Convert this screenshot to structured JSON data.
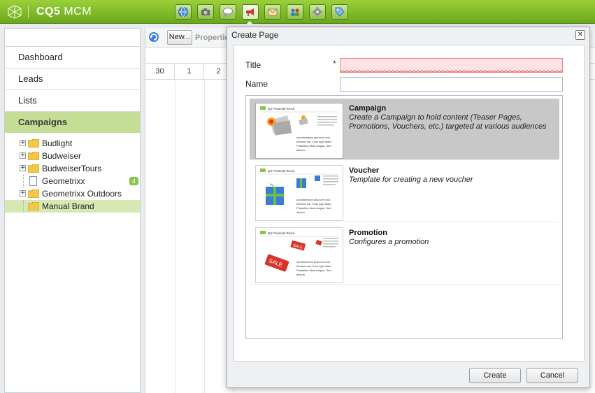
{
  "app": {
    "brand_bold": "CQ5",
    "brand_rest": " MCM"
  },
  "toolbar": {
    "icons": [
      "globe-icon",
      "camera-icon",
      "speech-bubble-icon",
      "megaphone-icon",
      "envelope-icon",
      "users-icon",
      "gear-icon",
      "tag-icon"
    ],
    "active_index": 3
  },
  "sidebar": {
    "nav": [
      "Dashboard",
      "Leads",
      "Lists",
      "Campaigns"
    ],
    "selected_nav": "Campaigns",
    "tree": [
      {
        "label": "Budlight",
        "type": "folder",
        "expandable": true
      },
      {
        "label": "Budweiser",
        "type": "folder",
        "expandable": true
      },
      {
        "label": "BudweiserTours",
        "type": "folder",
        "expandable": true
      },
      {
        "label": "Geometrixx",
        "type": "page",
        "expandable": false,
        "badge": "4"
      },
      {
        "label": "Geometrixx Outdoors",
        "type": "folder",
        "expandable": true
      },
      {
        "label": "Manual Brand",
        "type": "folder",
        "expandable": false,
        "selected": true
      }
    ]
  },
  "calendar": {
    "new_label": "New...",
    "properties_label": "Propertie",
    "days": [
      "30",
      "1",
      "2"
    ]
  },
  "dialog": {
    "title": "Create Page",
    "close_glyph": "✕",
    "title_label": "Title",
    "required_mark": "*",
    "title_value": "",
    "name_label": "Name",
    "name_value": "",
    "templates": [
      {
        "title": "Campaign",
        "description": "Create a Campaign to hold content (Teaser Pages, Promotions, Vouchers, etc.) targeted at various audiences",
        "selected": true
      },
      {
        "title": "Voucher",
        "description": "Template for creating a new voucher",
        "selected": false
      },
      {
        "title": "Promotion",
        "description": "Configures a promotion",
        "selected": false
      }
    ],
    "thumb_heading": "Q4 Financial Resul",
    "thumb_text": "condimentum ipsum et orci. Aenean est. Cras eget diam. Phasellus vitae magna. Sed dictum.",
    "thumb_badge": "SALE",
    "create_label": "Create",
    "cancel_label": "Cancel"
  },
  "colors": {
    "topbar": "#7cb82b",
    "selected_nav": "#c5de95",
    "error_field": "#fde3e3"
  }
}
